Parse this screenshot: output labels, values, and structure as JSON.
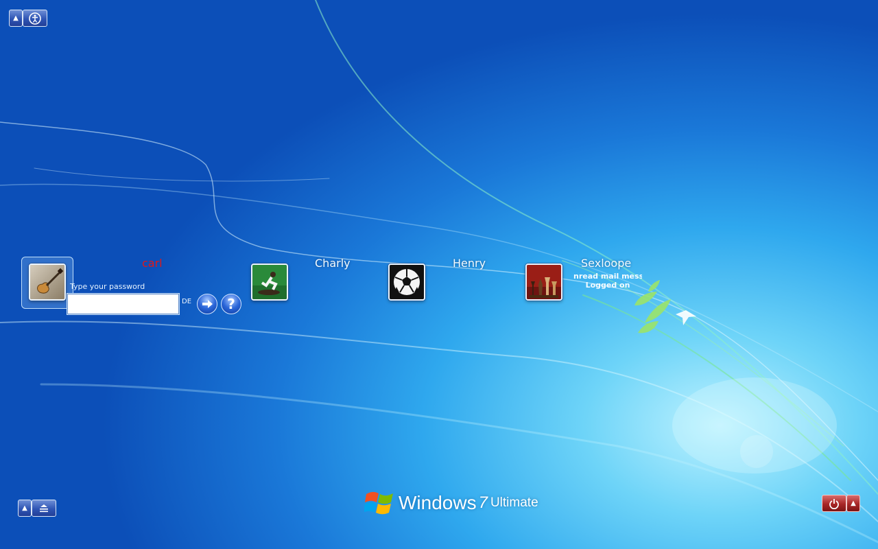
{
  "users": [
    {
      "name": "carl",
      "active": true,
      "picture": "guitar-picture"
    },
    {
      "name": "Charly",
      "active": false,
      "picture": "skateboarder-picture"
    },
    {
      "name": "Henry",
      "active": false,
      "picture": "soccer-ball-picture"
    },
    {
      "name": "Sexloope",
      "active": false,
      "picture": "chess-picture",
      "status_line1": "nread mail messa",
      "status_line2": "Logged on"
    }
  ],
  "login": {
    "password_label": "Type your password",
    "password_value": "",
    "language": "DE",
    "submit_icon": "arrow-right-icon",
    "help_label": "?"
  },
  "logo": {
    "brand": "Windows",
    "version": "7",
    "edition": "Ultimate"
  },
  "colors": {
    "active_user_name": "#e01818",
    "power_button": "#a82626",
    "accent_blue": "#2f55b4"
  }
}
